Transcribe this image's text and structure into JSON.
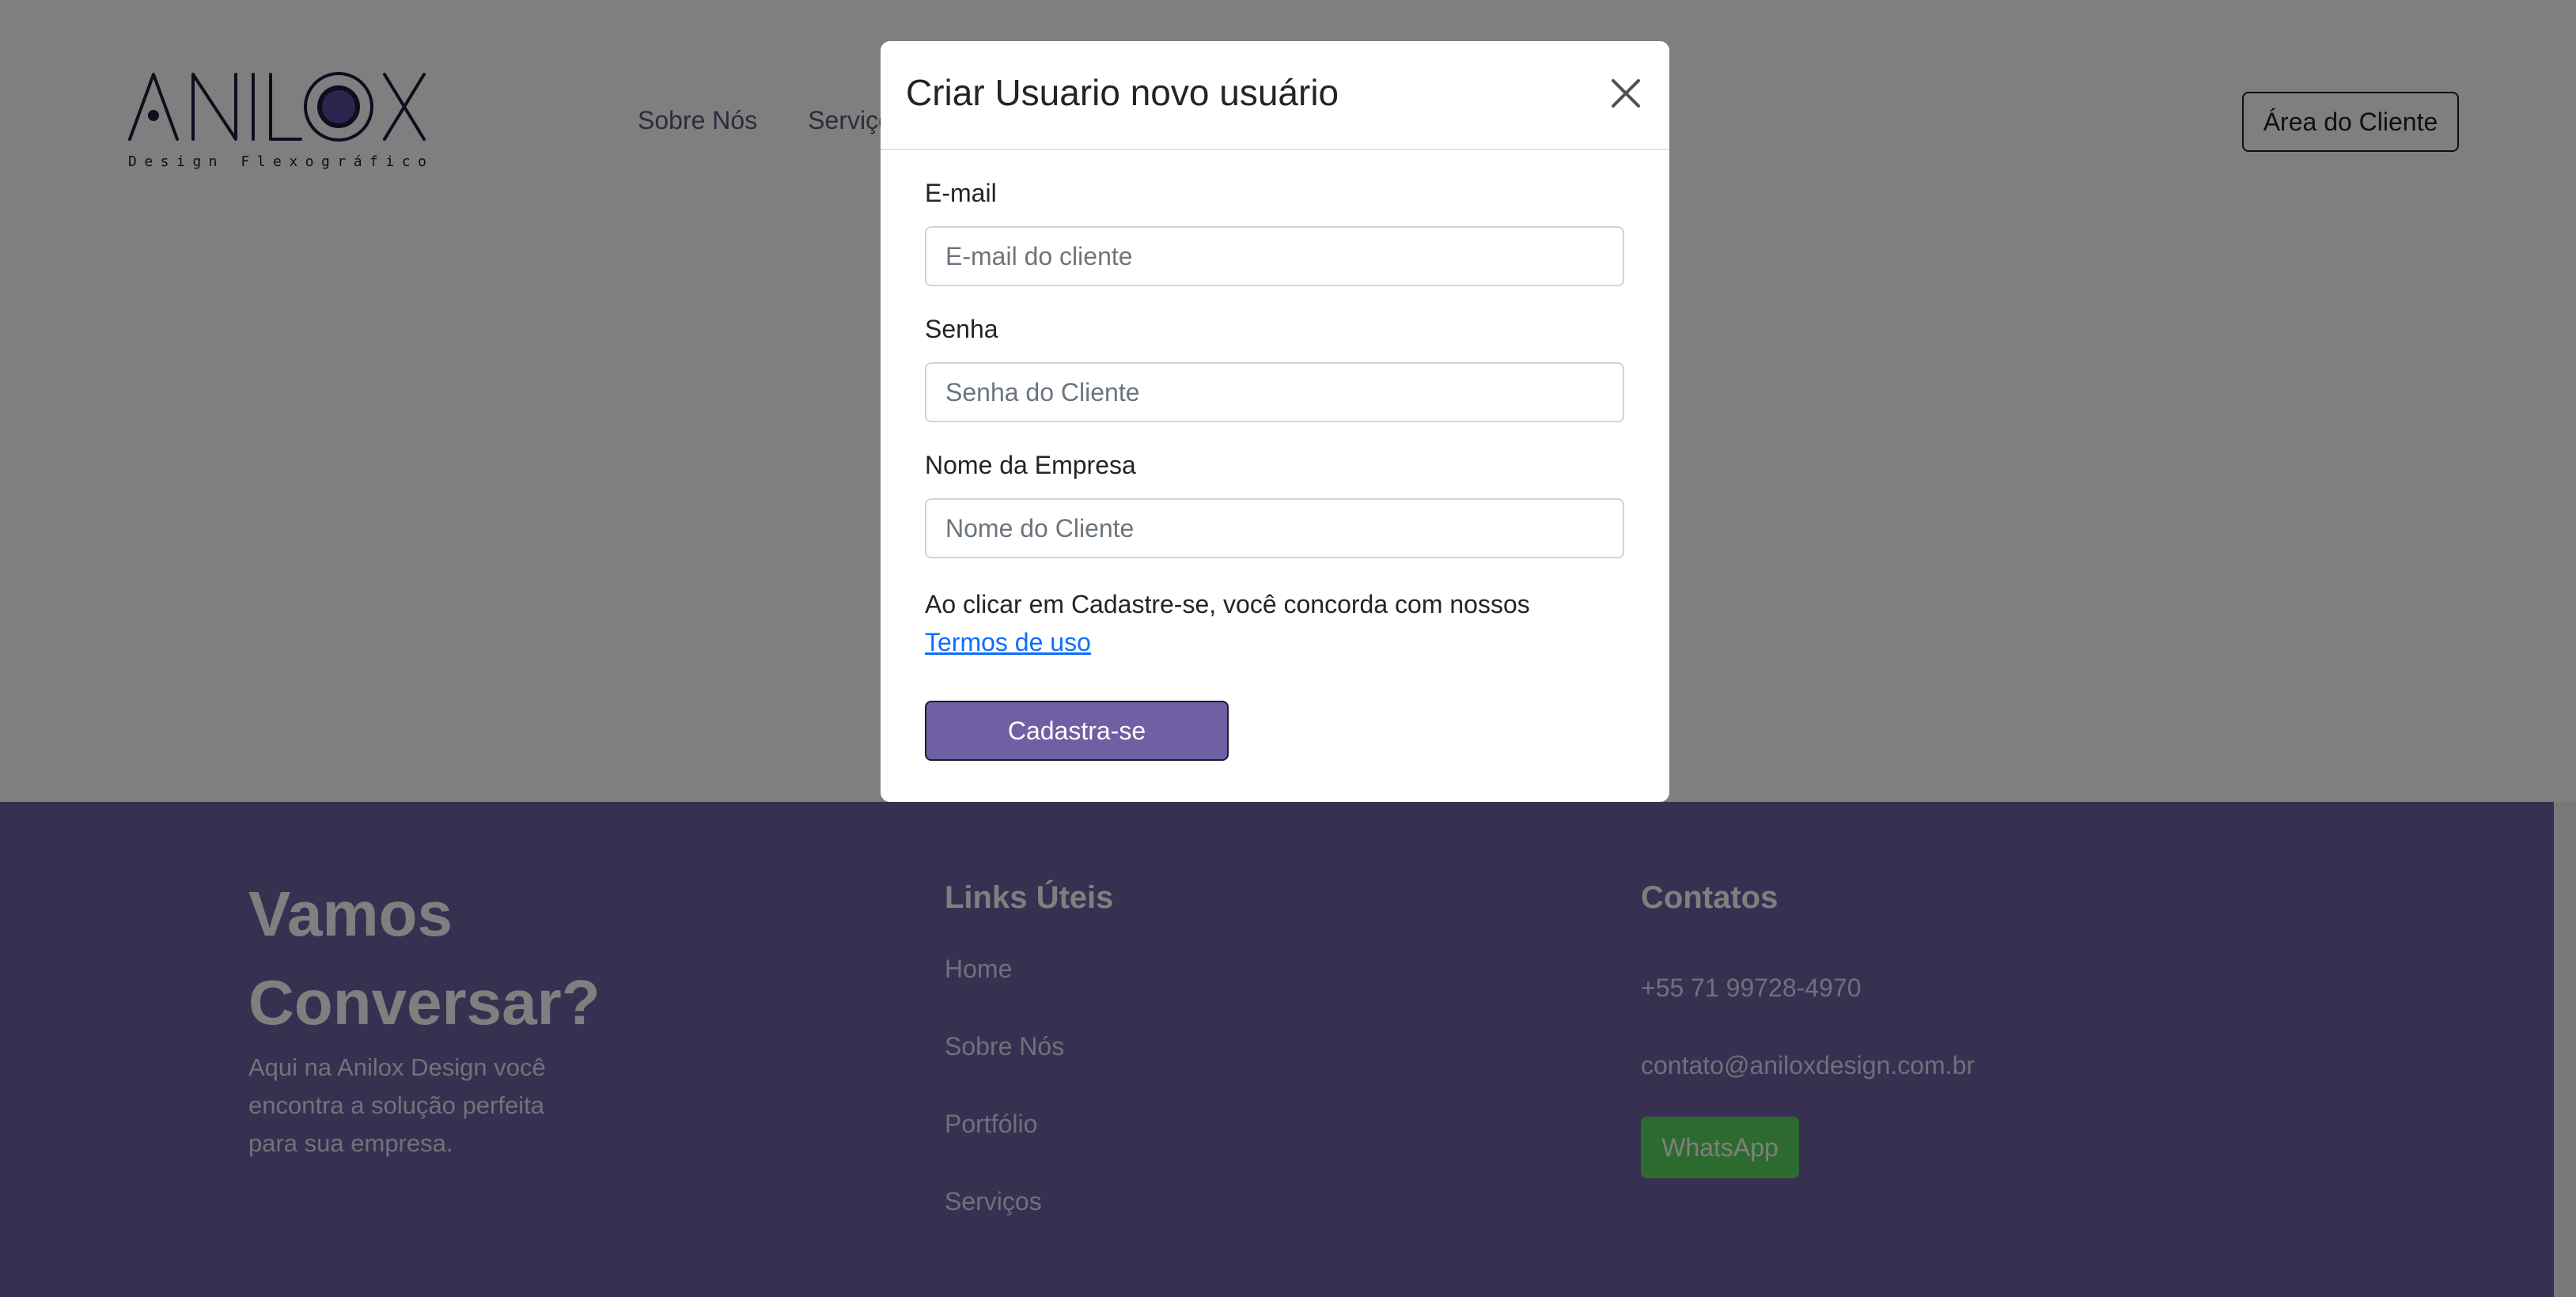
{
  "header": {
    "logo": {
      "wordmark": "ANILOX",
      "tagline": "Design Flexográfico"
    },
    "nav": [
      {
        "label": "Sobre Nós"
      },
      {
        "label": "Serviços"
      }
    ],
    "client_area_label": "Área do Cliente"
  },
  "modal": {
    "title": "Criar Usuario novo usuário",
    "fields": [
      {
        "label": "E-mail",
        "placeholder": "E-mail do cliente",
        "value": ""
      },
      {
        "label": "Senha",
        "placeholder": "Senha do Cliente",
        "value": ""
      },
      {
        "label": "Nome da Empresa",
        "placeholder": "Nome do Cliente",
        "value": ""
      }
    ],
    "terms_text": "Ao clicar em Cadastre-se, você concorda com nossos",
    "terms_link": "Termos de uso",
    "submit_label": "Cadastra-se"
  },
  "footer": {
    "heading_line1": "Vamos",
    "heading_line2": "Conversar?",
    "description": "Aqui na Anilox Design você encontra a solução perfeita para sua empresa.",
    "links_title": "Links Úteis",
    "links": [
      {
        "label": "Home"
      },
      {
        "label": "Sobre Nós"
      },
      {
        "label": "Portfólio"
      },
      {
        "label": "Serviços"
      }
    ],
    "contacts_title": "Contatos",
    "phone": "+55 71 99728-4970",
    "email": "contato@aniloxdesign.com.br",
    "whatsapp_label": "WhatsApp"
  },
  "colors": {
    "brand_purple": "#6f60a3",
    "logo_dark": "#1e1a3c",
    "whatsapp_green": "#5bd45e",
    "link_blue": "#0d6efd",
    "backdrop": "rgba(0,0,0,0.5)"
  },
  "icons": {
    "close": "close-icon",
    "logo_lens": "lens-icon"
  }
}
